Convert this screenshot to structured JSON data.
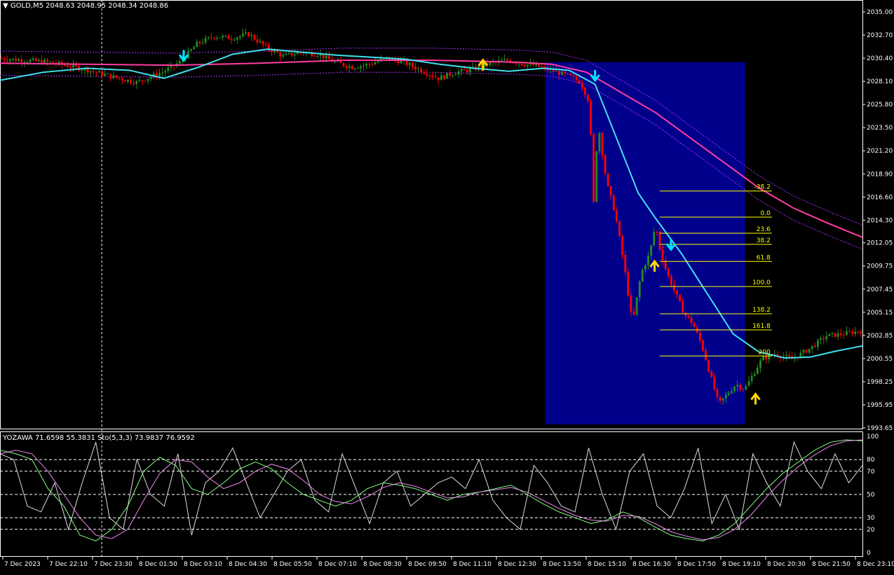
{
  "chart_header": {
    "symbol_label": "GOLD,M5",
    "ohlc_text": "2048.63 2048.95 2048.34 2048.86",
    "subwindow_label": "YOZAWA 71.6598 55.3831  Sto(5,3,3) 73.9837 76.9592"
  },
  "colors": {
    "background": "#000000",
    "bull_candle": "#228b22",
    "bear_candle": "#ff0000",
    "ema_fast": "#40e0f0",
    "ema_slow": "#ff3ca0",
    "band": "#b030ff",
    "highlight_box": "#00008b",
    "fib_lines": "#ffff00",
    "arrow_up": "#ffd700",
    "arrow_down": "#00e5ff",
    "osc_white": "#dddddd",
    "osc_green": "#7fff7f",
    "osc_magenta": "#ee88ee"
  },
  "chart_data": [
    {
      "type": "candlestick",
      "title": "GOLD,M5",
      "ylim": [
        1993.65,
        2035.0
      ],
      "y_ticks": [
        "2035.00",
        "2032.70",
        "2030.40",
        "2028.10",
        "2025.80",
        "2023.50",
        "2021.20",
        "2018.90",
        "2016.60",
        "2014.30",
        "2012.05",
        "2009.75",
        "2007.45",
        "2005.15",
        "2002.85",
        "2000.55",
        "1998.25",
        "1995.95",
        "1993.65"
      ],
      "x_ticks": [
        "7 Dec 2023",
        "7 Dec 22:10",
        "7 Dec 23:30",
        "8 Dec 01:50",
        "8 Dec 03:10",
        "8 Dec 04:30",
        "8 Dec 05:50",
        "8 Dec 07:10",
        "8 Dec 08:30",
        "8 Dec 09:50",
        "8 Dec 11:10",
        "8 Dec 12:30",
        "8 Dec 13:50",
        "8 Dec 15:10",
        "8 Dec 16:30",
        "8 Dec 17:50",
        "8 Dec 19:10",
        "8 Dec 20:30",
        "8 Dec 21:50",
        "8 Dec 23:10"
      ],
      "x_range": [
        0,
        1
      ],
      "price_path": [
        [
          0.0,
          2030.4
        ],
        [
          0.06,
          2030.0
        ],
        [
          0.1,
          2029.3
        ],
        [
          0.13,
          2028.6
        ],
        [
          0.16,
          2028.0
        ],
        [
          0.19,
          2029.0
        ],
        [
          0.21,
          2030.0
        ],
        [
          0.23,
          2031.8
        ],
        [
          0.25,
          2032.6
        ],
        [
          0.27,
          2032.4
        ],
        [
          0.29,
          2032.8
        ],
        [
          0.31,
          2031.5
        ],
        [
          0.33,
          2030.6
        ],
        [
          0.35,
          2031.0
        ],
        [
          0.37,
          2030.8
        ],
        [
          0.39,
          2030.0
        ],
        [
          0.41,
          2029.5
        ],
        [
          0.43,
          2029.8
        ],
        [
          0.45,
          2030.4
        ],
        [
          0.47,
          2030.0
        ],
        [
          0.49,
          2029.2
        ],
        [
          0.51,
          2028.4
        ],
        [
          0.53,
          2029.0
        ],
        [
          0.55,
          2029.3
        ],
        [
          0.57,
          2029.9
        ],
        [
          0.59,
          2030.2
        ],
        [
          0.61,
          2029.8
        ],
        [
          0.625,
          2029.6
        ],
        [
          0.64,
          2029.2
        ],
        [
          0.655,
          2028.8
        ],
        [
          0.665,
          2028.5
        ],
        [
          0.675,
          2028.0
        ],
        [
          0.685,
          2026.0
        ],
        [
          0.69,
          2016.0
        ],
        [
          0.695,
          2024.0
        ],
        [
          0.705,
          2018.0
        ],
        [
          0.715,
          2015.0
        ],
        [
          0.725,
          2010.0
        ],
        [
          0.735,
          2004.0
        ],
        [
          0.745,
          2009.0
        ],
        [
          0.755,
          2011.0
        ],
        [
          0.762,
          2014.0
        ],
        [
          0.765,
          2012.0
        ],
        [
          0.775,
          2009.0
        ],
        [
          0.785,
          2007.0
        ],
        [
          0.795,
          2005.0
        ],
        [
          0.805,
          2004.0
        ],
        [
          0.815,
          2002.0
        ],
        [
          0.825,
          1999.0
        ],
        [
          0.835,
          1996.0
        ],
        [
          0.845,
          1997.0
        ],
        [
          0.855,
          1998.0
        ],
        [
          0.865,
          1997.5
        ],
        [
          0.875,
          1999.0
        ],
        [
          0.885,
          2000.5
        ],
        [
          0.9,
          2001.0
        ],
        [
          0.92,
          2000.5
        ],
        [
          0.94,
          2001.5
        ],
        [
          0.96,
          2002.8
        ],
        [
          0.98,
          2003.0
        ],
        [
          1.0,
          2003.3
        ]
      ],
      "ema_fast": [
        [
          0.0,
          2028.2
        ],
        [
          0.05,
          2029.0
        ],
        [
          0.1,
          2029.4
        ],
        [
          0.15,
          2029.2
        ],
        [
          0.19,
          2028.4
        ],
        [
          0.23,
          2029.5
        ],
        [
          0.27,
          2030.8
        ],
        [
          0.31,
          2031.3
        ],
        [
          0.35,
          2031.0
        ],
        [
          0.39,
          2030.7
        ],
        [
          0.43,
          2030.5
        ],
        [
          0.47,
          2030.3
        ],
        [
          0.51,
          2029.8
        ],
        [
          0.55,
          2029.4
        ],
        [
          0.59,
          2029.1
        ],
        [
          0.63,
          2029.4
        ],
        [
          0.66,
          2029.2
        ],
        [
          0.69,
          2027.8
        ],
        [
          0.71,
          2023.5
        ],
        [
          0.74,
          2017.0
        ],
        [
          0.76,
          2014.5
        ],
        [
          0.79,
          2011.0
        ],
        [
          0.82,
          2007.0
        ],
        [
          0.85,
          2003.0
        ],
        [
          0.88,
          2001.2
        ],
        [
          0.91,
          2000.6
        ],
        [
          0.94,
          2000.7
        ],
        [
          0.97,
          2001.3
        ],
        [
          1.0,
          2001.8
        ]
      ],
      "ema_slow": [
        [
          0.0,
          2029.9
        ],
        [
          0.1,
          2029.8
        ],
        [
          0.2,
          2029.7
        ],
        [
          0.3,
          2029.9
        ],
        [
          0.4,
          2030.2
        ],
        [
          0.5,
          2030.2
        ],
        [
          0.6,
          2030.0
        ],
        [
          0.64,
          2029.8
        ],
        [
          0.68,
          2029.0
        ],
        [
          0.72,
          2027.0
        ],
        [
          0.76,
          2025.0
        ],
        [
          0.8,
          2022.5
        ],
        [
          0.84,
          2020.0
        ],
        [
          0.88,
          2017.5
        ],
        [
          0.92,
          2015.5
        ],
        [
          0.96,
          2014.0
        ],
        [
          1.0,
          2012.6
        ]
      ],
      "fibonacci": {
        "levels": [
          "-38.2",
          "0.0",
          "23.6",
          "38.2",
          "61.8",
          "100.0",
          "138.2",
          "161.8",
          "200"
        ],
        "prices": [
          2017.2,
          2014.6,
          2013.0,
          2011.9,
          2010.2,
          2007.7,
          2005.0,
          2003.4,
          2000.8
        ]
      },
      "highlight_range": {
        "x0": 0.632,
        "x1": 0.864,
        "y_top": 2030.0,
        "y_bottom": 1994.0
      },
      "arrows": [
        {
          "dir": "down",
          "x": 0.213,
          "y": 2030.6
        },
        {
          "dir": "up",
          "x": 0.56,
          "y": 2029.8
        },
        {
          "dir": "down",
          "x": 0.69,
          "y": 2028.6
        },
        {
          "dir": "up",
          "x": 0.759,
          "y": 2009.8
        },
        {
          "dir": "down",
          "x": 0.778,
          "y": 2011.8
        },
        {
          "dir": "up",
          "x": 0.876,
          "y": 1996.6
        }
      ]
    },
    {
      "type": "line",
      "title": "YOZAWA 71.6598 55.3831  Sto(5,3,3) 73.9837 76.9592",
      "ylim": [
        0,
        100
      ],
      "y_ticks": [
        "100",
        "80",
        "70",
        "50",
        "30",
        "20",
        "0"
      ],
      "series": [
        {
          "values": [
            85,
            80,
            40,
            35,
            60,
            20,
            60,
            95,
            30,
            20,
            80,
            50,
            40,
            85,
            15,
            60,
            70,
            90,
            60,
            30,
            50,
            70,
            80,
            45,
            35,
            85,
            55,
            25,
            60,
            70,
            40,
            50,
            60,
            65,
            55,
            80,
            45,
            30,
            20,
            75,
            60,
            40,
            35,
            90,
            50,
            20,
            70,
            85,
            40,
            30,
            55,
            90,
            25,
            50,
            20,
            85,
            60,
            40,
            95,
            70,
            55,
            85,
            60,
            75
          ]
        },
        {
          "values": [
            88,
            85,
            80,
            55,
            40,
            15,
            10,
            20,
            40,
            70,
            82,
            75,
            55,
            50,
            60,
            72,
            78,
            72,
            60,
            50,
            45,
            40,
            45,
            55,
            60,
            58,
            55,
            50,
            45,
            50,
            52,
            55,
            58,
            50,
            42,
            35,
            30,
            25,
            28,
            35,
            30,
            22,
            15,
            12,
            10,
            15,
            25,
            40,
            55,
            68,
            78,
            88,
            95,
            97,
            96
          ]
        },
        {
          "values": [
            85,
            88,
            85,
            70,
            50,
            30,
            15,
            12,
            20,
            45,
            68,
            80,
            78,
            65,
            55,
            60,
            70,
            76,
            72,
            62,
            50,
            44,
            42,
            48,
            56,
            60,
            57,
            52,
            47,
            48,
            52,
            54,
            56,
            52,
            45,
            38,
            32,
            28,
            27,
            32,
            31,
            25,
            18,
            14,
            11,
            13,
            20,
            32,
            48,
            62,
            74,
            84,
            92,
            96,
            97
          ]
        }
      ]
    }
  ]
}
